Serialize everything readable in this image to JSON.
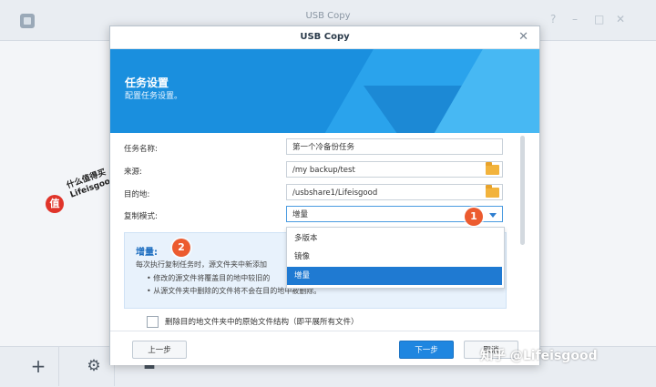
{
  "background_app": {
    "title": "USB Copy",
    "window_controls": [
      "?",
      "–",
      "□",
      "✕"
    ],
    "toolbar_buttons": [
      {
        "icon": "plus-icon",
        "glyph": "+"
      },
      {
        "icon": "gear-icon",
        "glyph": "⚙"
      },
      {
        "icon": "log-icon",
        "glyph": "▬"
      }
    ]
  },
  "watermark": {
    "logo_char": "值",
    "line1": "什么值得买",
    "line2": "Lifeisgood",
    "corner": "知乎 @Lifeisgood"
  },
  "dialog": {
    "title": "USB Copy",
    "close_glyph": "✕",
    "banner": {
      "title": "任务设置",
      "subtitle": "配置任务设置。"
    },
    "form": {
      "task_name": {
        "label": "任务名称:",
        "value": "第一个冷备份任务"
      },
      "source": {
        "label": "来源:",
        "value": "/my backup/test"
      },
      "destination": {
        "label": "目的地:",
        "value": "/usbshare1/Lifeisgood"
      },
      "copy_mode": {
        "label": "复制模式:",
        "value": "增量",
        "options": [
          "多版本",
          "镜像",
          "增量"
        ],
        "selected_index": 2
      }
    },
    "info": {
      "title": "增量:",
      "line1": "每次执行复制任务时，源文件夹中新添加",
      "bullet1": "修改的源文件将覆盖目的地中较旧的",
      "bullet2": "从源文件夹中删除的文件将不会在目的地中被删除。"
    },
    "flatten_option": {
      "label": "删除目的地文件夹中的原始文件结构（即平展所有文件）",
      "checked": false
    },
    "buttons": {
      "prev": "上一步",
      "next": "下一步",
      "cancel": "取消"
    }
  },
  "annotations": {
    "badge1": "1",
    "badge2": "2"
  },
  "colors": {
    "accent": "#1f7ad2",
    "banner": "#1a8fde",
    "badge": "#ec5b2f"
  }
}
